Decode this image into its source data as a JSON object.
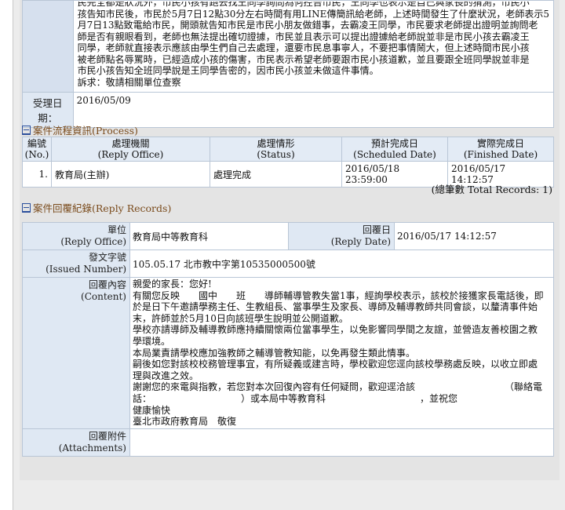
{
  "complaint": {
    "lines": [
      "民完全都是狀況外，市民小孩有跑去找王同學詢問為何控告市民，王同學也表示是自己與家長的猜測，市民小",
      "孩告知市民後，市民於5月7日12點30分左右時間有用LINE傳簡訊給老師，上述時間發生了什麼狀況，老師表示5",
      "月7日13點致電給市民，開頭就告知市民是市民小朋友做錯事，去霸凌王同學，市民要求老師提出證明並詢問老",
      "師是否有親眼看到，老師也無法提出確切證據，市民並且表示可以提出證據給老師說並非是市民小孩去霸凌王",
      "同學，老師就直接表示應該由學生們自己去處理，還要市民息事寧人，不要把事情鬧大，但上述時間市民小孩",
      "被老師點名辱罵時，已經造成小孩的傷害，市民表示希望老師要跟市民小孩道歉，並且要跟全班同學說並非是",
      "市民小孩告知全班同學說是王同學告密的，因市民小孩並未做這件事情。",
      "訴求：敬請相關單位查察"
    ]
  },
  "acceptance": {
    "label": "受理日期：",
    "date": "2016/05/09"
  },
  "process": {
    "title": "案件流程資訊(Process)",
    "headers": {
      "no_zh": "編號",
      "no_en": "(No.)",
      "office_zh": "處理機關",
      "office_en": "(Reply Office)",
      "status_zh": "處理情形",
      "status_en": "(Status)",
      "sched_zh": "預計完成日",
      "sched_en": "(Scheduled Date)",
      "finish_zh": "實際完成日",
      "finish_en": "(Finished Date)"
    },
    "rows": [
      {
        "no": "1.",
        "office": "教育局(主辦)",
        "status": "處理完成",
        "scheduled": "2016/05/18 23:59:00",
        "finished": "2016/05/17 14:12:57"
      }
    ],
    "total": "(總筆數 Total Records: 1)"
  },
  "reply": {
    "title": "案件回覆紀錄(Reply Records)",
    "unit_label_zh": "單位",
    "unit_label_en": "(Reply Office)",
    "unit_value": "教育局中等教育科",
    "date_label_zh": "回覆日",
    "date_label_en": "(Reply Date)",
    "date_value": "2016/05/17 14:12:57",
    "issued_label_zh": "發文字號",
    "issued_label_en": "(Issued Number)",
    "issued_value": "105.05.17 北市教中字第10535000500號",
    "content_label_zh": "回覆內容",
    "content_label_en": "(Content)",
    "content_lines": [
      "親愛的家長：您好!",
      "有關您反映　　國中　　班　　導師輔導管教失當1事，經詢學校表示，該校於接獲家長電話後，即",
      "於是日下午邀請學務主任、生教組長、當事學生及家長、導師及輔導教師共同會談，以釐清事件始",
      "末，許師並於5月10日向該班學生說明並公開道歉。",
      "學校亦請導師及輔導教師應持續關懷兩位當事學生，以免影響同學間之友誼，並營造友善校園之教",
      "學環境。",
      "本局業責請學校應加強教師之輔導管教知能，以免再發生類此情事。",
      "嗣後如您對該校校務管理事宜，有所疑義或建言時，學校歡迎您逕向該校學務處反映，以收立即處",
      "理與改進之效。",
      "謝謝您的來電與指教，若您對本次回復內容有任何疑問，歡迎逕洽該　　　　　　　　　　（聯絡電",
      "話：　　　　　　　　　　）或本局中等教育科　　　　　　　　　　，並祝您",
      "健康愉快",
      "臺北市政府教育局　敬復"
    ],
    "attach_label_zh": "回覆附件",
    "attach_label_en": "(Attachments)"
  }
}
